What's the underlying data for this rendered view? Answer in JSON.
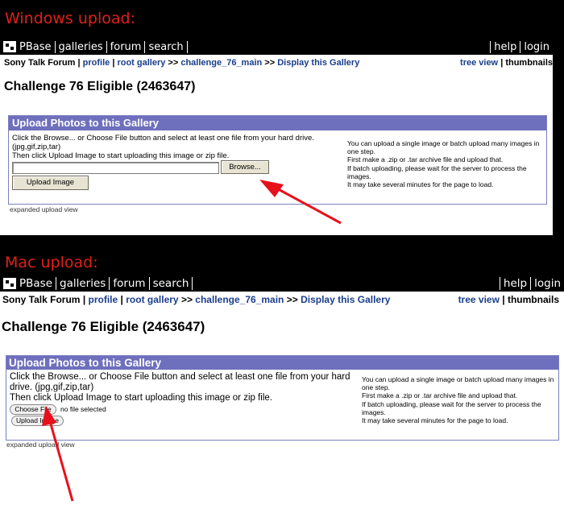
{
  "captions": {
    "windows": "Windows upload:",
    "mac": "Mac upload:"
  },
  "nav": {
    "brand": "PBase",
    "items": [
      "galleries",
      "forum",
      "search"
    ],
    "right": [
      "help",
      "login"
    ]
  },
  "breadcrumb": {
    "forum": "Sony Talk Forum",
    "sep": "|",
    "profile": "profile",
    "root_gallery": "root gallery",
    "arrow": ">>",
    "gallery_main": "challenge_76_main",
    "display": "Display this Gallery",
    "tree_view": "tree view",
    "thumbnails": "thumbnails"
  },
  "gallery_title": "Challenge 76 Eligible (2463647)",
  "upload": {
    "header": "Upload Photos to this Gallery",
    "instr1": "Click the Browse... or Choose File button and select at least one file from your hard drive.",
    "instr_types": "(jpg,gif,zip,tar)",
    "instr2": "Then click Upload Image to start uploading this image or zip file.",
    "browse_label": "Browse...",
    "upload_label": "Upload Image",
    "choose_label": "Choose File",
    "no_file": "no file selected",
    "expanded_link": "expanded upload view",
    "info": [
      "You can upload a single image or batch upload many images in one step.",
      "First make a .zip or .tar archive file and upload that.",
      "If batch uploading, please wait for the server to process the images.",
      "It may take several minutes for the page to load."
    ]
  },
  "colors": {
    "caption": "#e0201a",
    "header_bg": "#6e6fbd",
    "link": "#1a3e8c",
    "arrow": "#e8101a"
  }
}
